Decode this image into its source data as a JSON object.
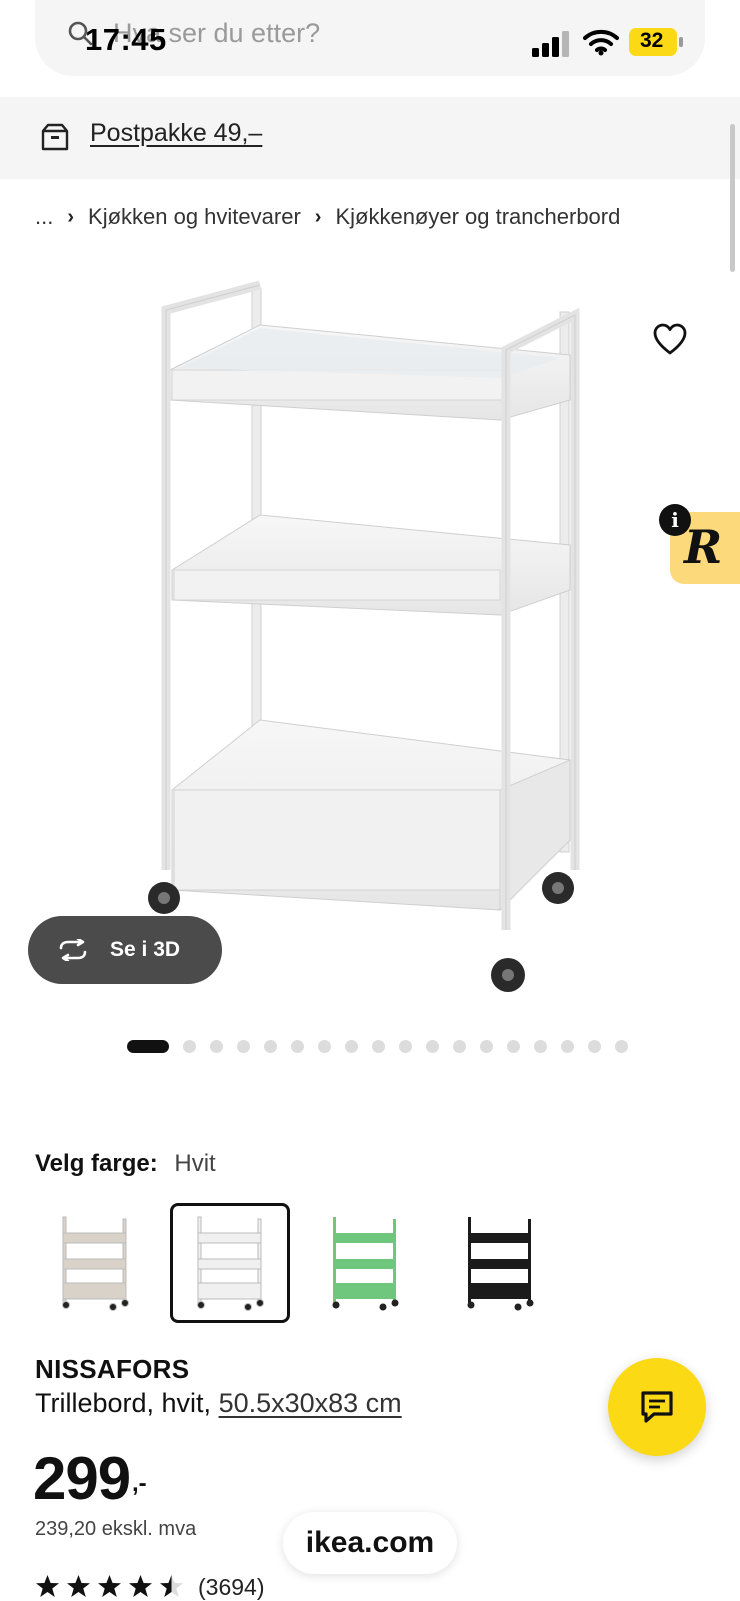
{
  "status_bar": {
    "time": "17:45",
    "battery": "32"
  },
  "search": {
    "placeholder": "Hva ser du etter?"
  },
  "banner": {
    "text": "Postpakke 49,–"
  },
  "breadcrumb": {
    "ellipsis": "...",
    "items": [
      "Kjøkken og hvitevarer",
      "Kjøkkenøyer og trancherbord"
    ]
  },
  "viewer": {
    "label_3d": "Se i 3D",
    "image_count": 18,
    "active_index": 0
  },
  "badge": {
    "letter": "R",
    "info": "i"
  },
  "color": {
    "label": "Velg farge:",
    "selected": "Hvit",
    "swatches": [
      {
        "name": "beige",
        "color": "#d8d2c8"
      },
      {
        "name": "white",
        "color": "#f0f0f0"
      },
      {
        "name": "green",
        "color": "#6fc77d"
      },
      {
        "name": "black",
        "color": "#1b1b1b"
      }
    ],
    "selected_index": 1
  },
  "product": {
    "name": "NISSAFORS",
    "description": "Trillebord, hvit, ",
    "size": "50.5x30x83 cm",
    "price": "299",
    "price_suffix": ",-",
    "price_ex_vat": "239,20 ekskl. mva",
    "rating": 4.5,
    "review_count": "(3694)"
  },
  "footer": {
    "url": "ikea.com"
  },
  "colors": {
    "accent_yellow": "#fbd914",
    "dark_button": "#4b4b4b"
  }
}
